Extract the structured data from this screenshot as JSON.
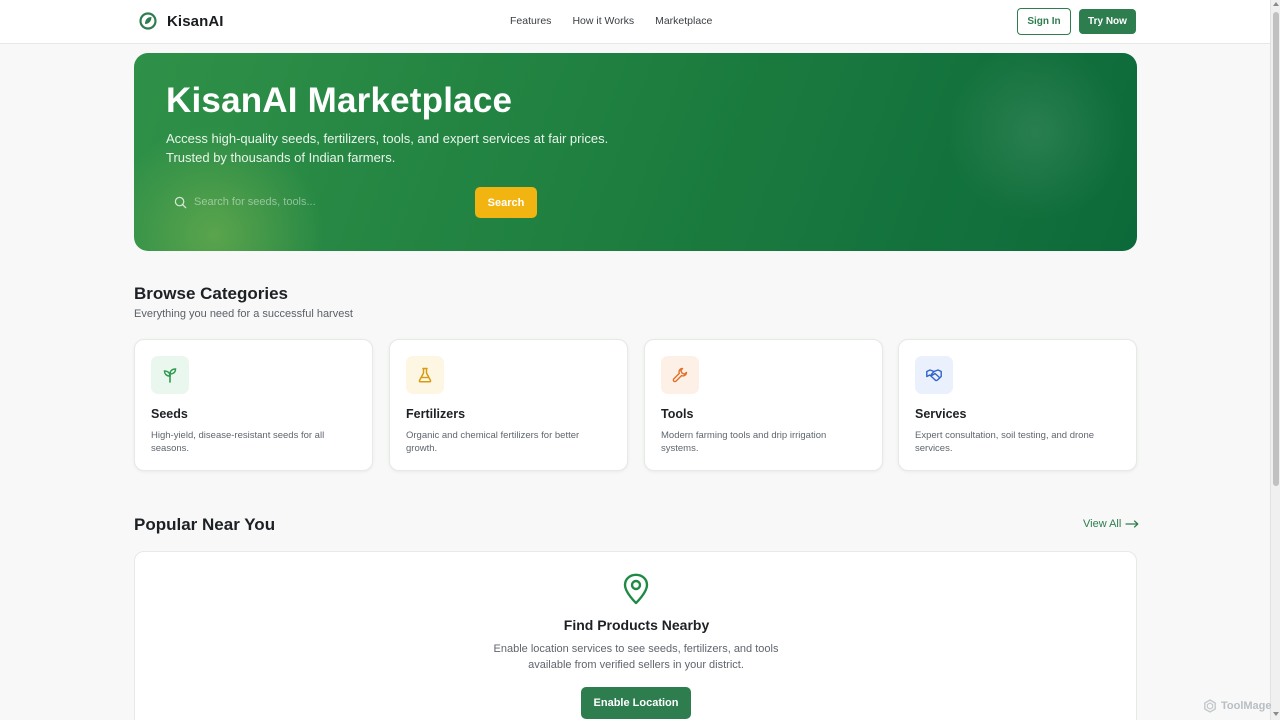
{
  "header": {
    "brand": "KisanAI",
    "nav": [
      "Features",
      "How it Works",
      "Marketplace"
    ],
    "sign_in": "Sign In",
    "try_now": "Try Now"
  },
  "hero": {
    "title": "KisanAI Marketplace",
    "subtitle_line1": "Access high-quality seeds, fertilizers, tools, and expert services at fair prices.",
    "subtitle_line2": "Trusted by thousands of Indian farmers.",
    "search_placeholder": "Search for seeds, tools...",
    "search_button": "Search"
  },
  "categories": {
    "title": "Browse Categories",
    "subtitle": "Everything you need for a successful harvest",
    "items": [
      {
        "title": "Seeds",
        "desc": "High-yield, disease-resistant seeds for all seasons.",
        "icon": "sprout-icon",
        "color": "#2e9a4f",
        "bg": "#eaf7ee"
      },
      {
        "title": "Fertilizers",
        "desc": "Organic and chemical fertilizers for better growth.",
        "icon": "flask-icon",
        "color": "#d99a12",
        "bg": "#fdf6e3"
      },
      {
        "title": "Tools",
        "desc": "Modern farming tools and drip irrigation systems.",
        "icon": "wrench-icon",
        "color": "#e2702a",
        "bg": "#fdf0e6"
      },
      {
        "title": "Services",
        "desc": "Expert consultation, soil testing, and drone services.",
        "icon": "handshake-icon",
        "color": "#2f63c9",
        "bg": "#eaf1fc"
      }
    ]
  },
  "popular": {
    "title": "Popular Near You",
    "view_all": "View All",
    "panel_title": "Find Products Nearby",
    "panel_desc_line1": "Enable location services to see seeds, fertilizers, and tools",
    "panel_desc_line2": "available from verified sellers in your district.",
    "enable_button": "Enable Location"
  },
  "watermark": "ToolMage"
}
